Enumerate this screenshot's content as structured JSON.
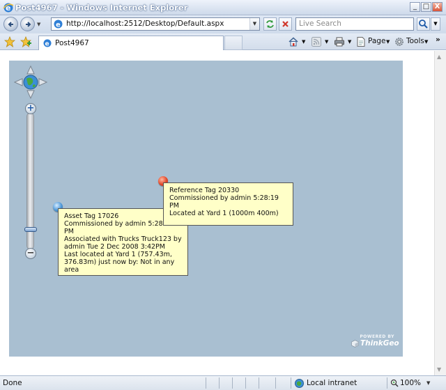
{
  "window": {
    "title": "Post4967 - Windows Internet Explorer",
    "controls": {
      "minimize": "_",
      "maximize": "□",
      "close": "X"
    }
  },
  "address_bar": {
    "url": "http://localhost:2512/Desktop/Default.aspx",
    "search_placeholder": "Live Search"
  },
  "tabs": [
    {
      "label": "Post4967",
      "active": true
    }
  ],
  "command_bar": {
    "page_label": "Page",
    "tools_label": "Tools",
    "overflow": "»"
  },
  "map": {
    "background_color": "#a9bfd1",
    "popups": {
      "asset": "Asset Tag 17026\nCommissioned by admin 5:28:19\nPM\nAssociated with Trucks Truck123 by\nadmin Tue 2 Dec 2008 3:42PM\nLast located at Yard 1 (757.43m,\n376.83m) just now by: Not in any\narea",
      "reference": "Reference Tag 20330\nCommissioned by admin 5:28:19\nPM\nLocated at Yard 1 (1000m 400m)"
    },
    "pins": [
      {
        "name": "reference",
        "color": "#e2492a"
      },
      {
        "name": "asset",
        "color": "#4f98d8"
      }
    ],
    "zoom_controls": {
      "plus": "+",
      "minus": "−"
    },
    "branding": {
      "powered_by": "POWERED BY",
      "brand": "ThinkGeo"
    }
  },
  "status_bar": {
    "status": "Done",
    "zone": "Local intranet",
    "zoom": "100%"
  }
}
